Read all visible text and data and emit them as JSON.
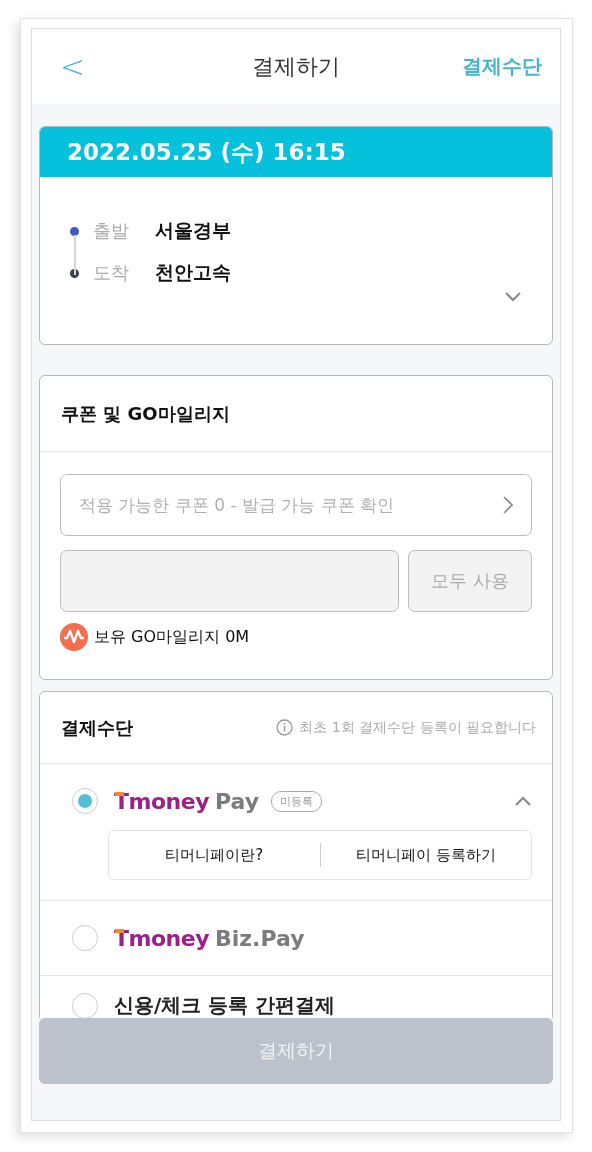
{
  "header": {
    "back": "<",
    "title": "결제하기",
    "action": "결제수단"
  },
  "trip": {
    "datetime": "2022.05.25 (수) 16:15",
    "expanded": false,
    "stops": [
      {
        "label": "출발",
        "place": "서울경부",
        "kind": "departure"
      },
      {
        "label": "도착",
        "place": "천안고속",
        "kind": "arrival"
      }
    ]
  },
  "coupon": {
    "title": "쿠폰 및 GO마일리지",
    "coupon_field": {
      "placeholder": "적용 가능한 쿠폰 0 - 발급 가능 쿠폰 확인"
    },
    "use_all_button": "모두 사용",
    "mileage": "보유 GO마일리지 0M"
  },
  "payment": {
    "title": "결제수단",
    "notice": "최초 1회 결제수단 등록이 필요합니다",
    "methods": [
      {
        "kind": "logo",
        "brand": "Tmoney",
        "product": "Pay",
        "badge": "미등록",
        "selected": true,
        "expanded": true,
        "links": [
          "티머니페이란?",
          "티머니페이 등록하기"
        ]
      },
      {
        "kind": "logo",
        "brand": "Tmoney",
        "product": "Biz.Pay",
        "selected": false
      },
      {
        "kind": "text",
        "label": "신용/체크 등록 간편결제",
        "selected": false
      }
    ]
  },
  "pay_button": {
    "label": "결제하기",
    "disabled": true
  }
}
